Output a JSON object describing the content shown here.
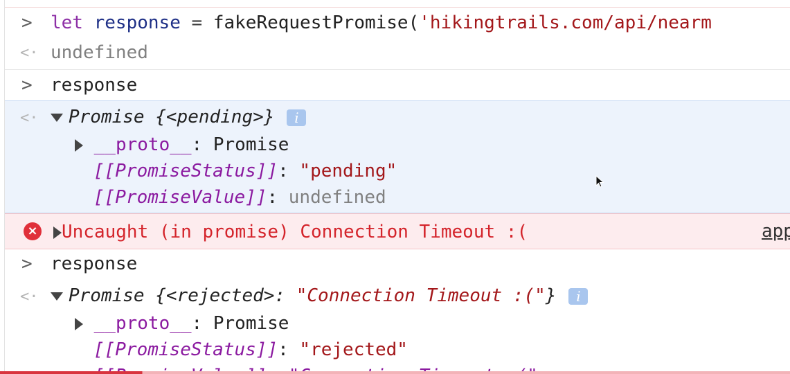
{
  "console": {
    "entries": [
      {
        "type": "input",
        "tokens": {
          "keyword": "let",
          "identifier": "response",
          "operator": "=",
          "function": "fakeRequestPromise(",
          "string": "'hikingtrails.com/api/nearm"
        }
      },
      {
        "type": "result",
        "text": "undefined"
      },
      {
        "type": "input",
        "text": "response"
      },
      {
        "type": "result-expanded",
        "promise_label": "Promise",
        "promise_state": "{<pending>}",
        "info_icon": "i",
        "proto_key": "__proto__",
        "proto_colon": ":",
        "proto_value": "Promise",
        "status_key": "[[PromiseStatus]]",
        "status_colon": ":",
        "status_value": "\"pending\"",
        "value_key": "[[PromiseValue]]",
        "value_colon": ":",
        "value_value": "undefined"
      },
      {
        "type": "error",
        "icon": "×",
        "message": "Uncaught (in promise) Connection Timeout :(",
        "source_link": "app"
      },
      {
        "type": "input",
        "text": "response"
      },
      {
        "type": "result-expanded",
        "promise_label": "Promise",
        "promise_open": "{<rejected>:",
        "promise_reason": "\"Connection Timeout :(\"",
        "promise_close": "}",
        "info_icon": "i",
        "proto_key": "__proto__",
        "proto_colon": ":",
        "proto_value": "Promise",
        "status_key": "[[PromiseStatus]]",
        "status_colon": ":",
        "status_value": "\"rejected\"",
        "value_partial": "[[PromiseValue]]: \"Connection Timeout :(\""
      }
    ]
  },
  "colors": {
    "keyword": "#8d2fa6",
    "identifier": "#1e2f86",
    "string": "#a3171a",
    "property": "#8b1aa0",
    "error_text": "#d4242b",
    "error_bg": "#fdecee",
    "highlight_bg": "#edf3fc",
    "info_badge": "#a9c6ee"
  },
  "icons": {
    "prompt": "chevron-right-icon",
    "result": "return-arrow-icon",
    "error": "error-circle-icon",
    "expand": "triangle-icon",
    "info": "info-icon",
    "cursor": "mouse-pointer-icon"
  }
}
